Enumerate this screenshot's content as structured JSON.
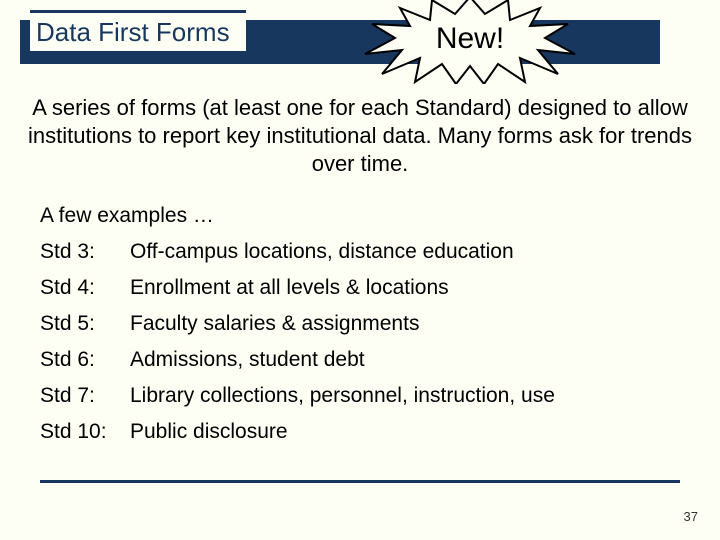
{
  "title": "Data First Forms",
  "burst_label": "New!",
  "intro": "A series of forms (at least one for each Standard) designed to allow institutions to report key institutional data.  Many forms ask for trends over time.",
  "examples_label": "A few examples …",
  "rows": [
    {
      "std": "Std 3:",
      "desc": "Off-campus locations, distance education"
    },
    {
      "std": "Std 4:",
      "desc": "Enrollment at all levels  & locations"
    },
    {
      "std": "Std 5:",
      "desc": "Faculty salaries & assignments"
    },
    {
      "std": "Std 6:",
      "desc": "Admissions, student debt"
    },
    {
      "std": "Std 7:",
      "desc": "Library collections, personnel, instruction, use"
    },
    {
      "std": "Std 10:",
      "desc": "Public disclosure"
    }
  ],
  "page_number": "37"
}
